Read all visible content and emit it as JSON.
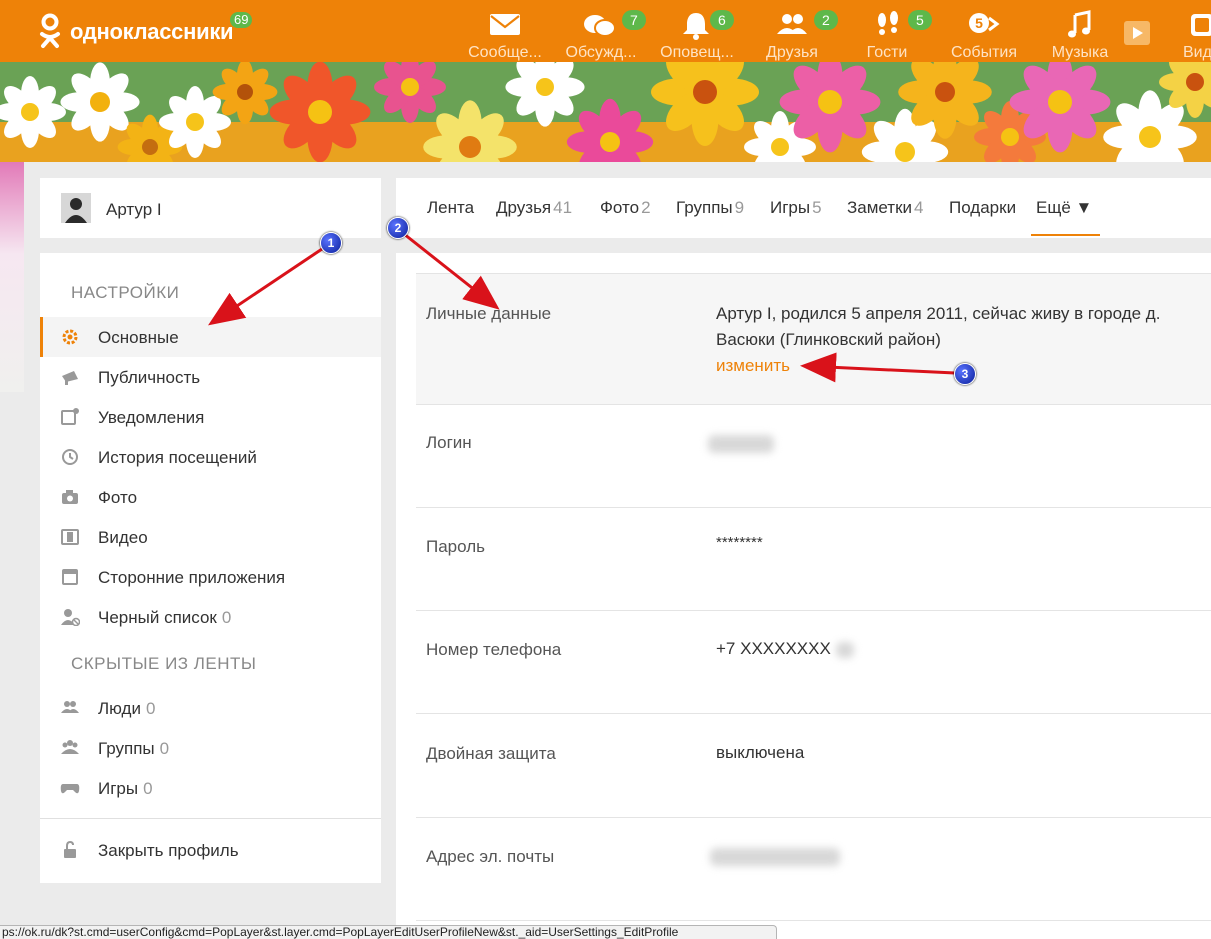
{
  "app": {
    "logo_text": "одноклассники",
    "logo_badge": "69",
    "brand_color": "#ee8208",
    "badge_color": "#5eb84a"
  },
  "topnav": [
    {
      "label": "Сообще...",
      "icon": "envelope-icon",
      "badge": ""
    },
    {
      "label": "Обсужд...",
      "icon": "chat-bubbles-icon",
      "badge": "7"
    },
    {
      "label": "Оповещ...",
      "icon": "bell-icon",
      "badge": "6"
    },
    {
      "label": "Друзья",
      "icon": "friends-icon",
      "badge": "2"
    },
    {
      "label": "Гости",
      "icon": "footprints-icon",
      "badge": "5"
    },
    {
      "label": "События",
      "icon": "events-icon",
      "badge": ""
    },
    {
      "label": "Музыка",
      "icon": "music-note-icon",
      "badge": ""
    },
    {
      "label": "",
      "icon": "video-play-icon",
      "badge": ""
    },
    {
      "label": "Вид",
      "icon": "video-icon",
      "badge": ""
    }
  ],
  "profile": {
    "name": "Артур I"
  },
  "tabs": [
    {
      "label": "Лента",
      "count": ""
    },
    {
      "label": "Друзья",
      "count": "41"
    },
    {
      "label": "Фото",
      "count": "2"
    },
    {
      "label": "Группы",
      "count": "9"
    },
    {
      "label": "Игры",
      "count": "5"
    },
    {
      "label": "Заметки",
      "count": "4"
    },
    {
      "label": "Подарки",
      "count": ""
    },
    {
      "label": "Ещё ▼",
      "count": ""
    }
  ],
  "sidebar": {
    "settings_title": "НАСТРОЙКИ",
    "settings_items": [
      {
        "label": "Основные",
        "icon": "gear-icon",
        "count": ""
      },
      {
        "label": "Публичность",
        "icon": "megaphone-icon",
        "count": ""
      },
      {
        "label": "Уведомления",
        "icon": "notification-icon",
        "count": ""
      },
      {
        "label": "История посещений",
        "icon": "history-icon",
        "count": ""
      },
      {
        "label": "Фото",
        "icon": "camera-icon",
        "count": ""
      },
      {
        "label": "Видео",
        "icon": "film-icon",
        "count": ""
      },
      {
        "label": "Сторонние приложения",
        "icon": "app-window-icon",
        "count": ""
      },
      {
        "label": "Черный список",
        "icon": "blocked-user-icon",
        "count": "0"
      }
    ],
    "hidden_title": "СКРЫТЫЕ ИЗ ЛЕНТЫ",
    "hidden_items": [
      {
        "label": "Люди",
        "icon": "people-icon",
        "count": "0"
      },
      {
        "label": "Группы",
        "icon": "groups-icon",
        "count": "0"
      },
      {
        "label": "Игры",
        "icon": "gamepad-icon",
        "count": "0"
      }
    ],
    "close_profile": {
      "label": "Закрыть профиль",
      "icon": "lock-icon"
    }
  },
  "settings": {
    "personal": {
      "label": "Личные данные",
      "value": "Артур I, родился 5 апреля 2011, сейчас живу в городе д. Васюки (Глинковский район)",
      "link": "изменить"
    },
    "login": {
      "label": "Логин",
      "value": ""
    },
    "password": {
      "label": "Пароль",
      "value": "********"
    },
    "phone": {
      "label": "Номер телефона",
      "value": "+7 XXXXXXXX"
    },
    "twofa": {
      "label": "Двойная защита",
      "value": "выключена"
    },
    "email": {
      "label": "Адрес эл. почты",
      "value": ""
    }
  },
  "annotations": [
    "1",
    "2",
    "3"
  ],
  "statusbar": "ps://ok.ru/dk?st.cmd=userConfig&cmd=PopLayer&st.layer.cmd=PopLayerEditUserProfileNew&st._aid=UserSettings_EditProfile"
}
